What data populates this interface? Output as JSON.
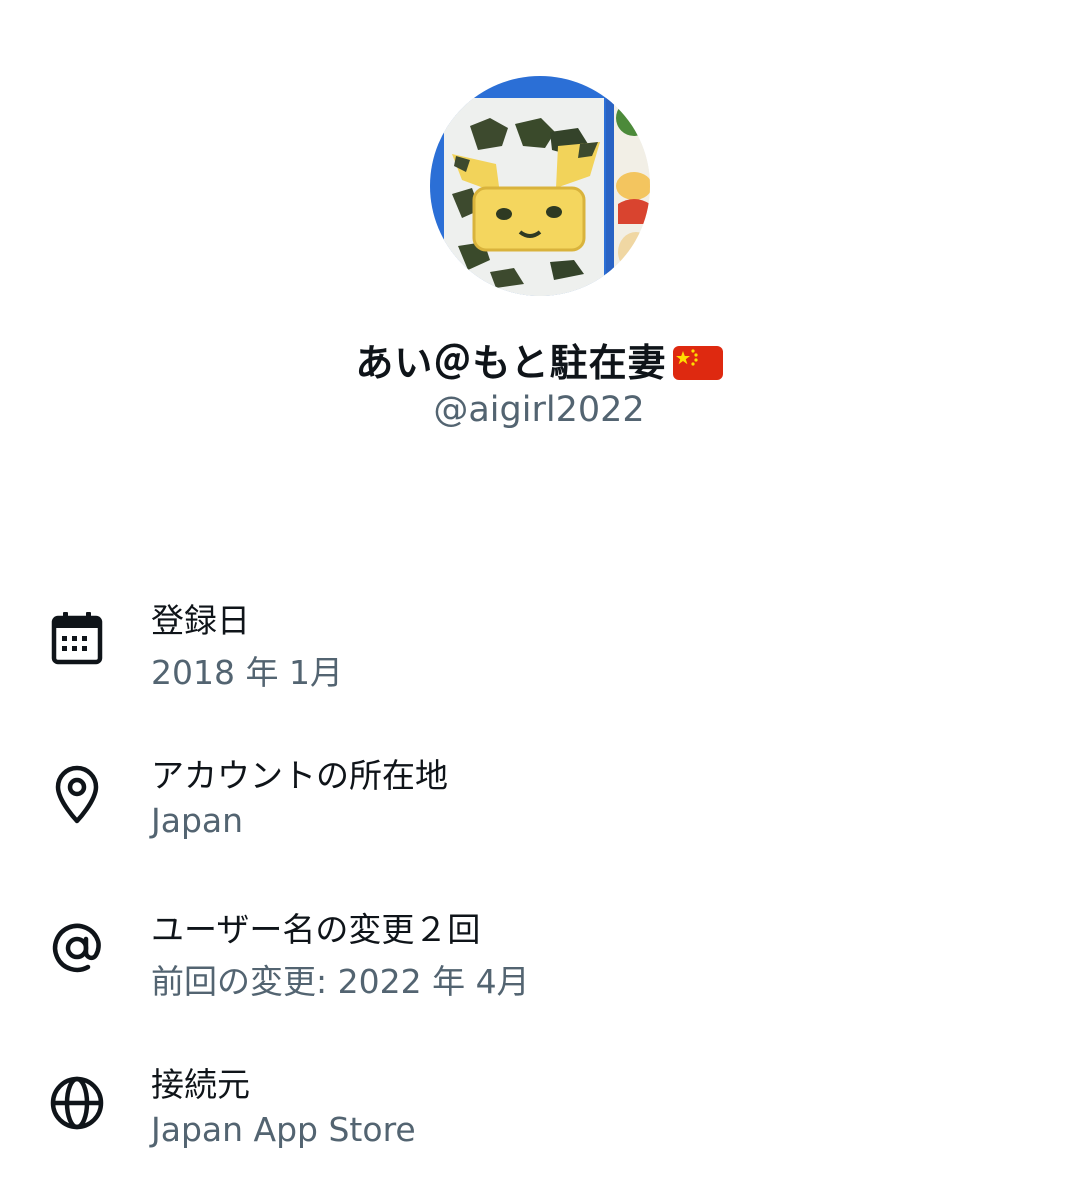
{
  "profile": {
    "display_name": "あい＠もと駐在妻",
    "handle": "@aigirl2022"
  },
  "icons": {
    "flag": "flag-china-icon"
  },
  "about": {
    "rows": [
      {
        "icon": "calendar-icon",
        "label": "登録日",
        "value": "2018 年 1月"
      },
      {
        "icon": "location-pin-icon",
        "label": "アカウントの所在地",
        "value": "Japan"
      },
      {
        "icon": "at-sign-icon",
        "label": "ユーザー名の変更２回",
        "value": "前回の変更: 2022 年 4月"
      },
      {
        "icon": "globe-icon",
        "label": "接続元",
        "value": "Japan App Store"
      }
    ]
  },
  "colors": {
    "primary_text": "#0f1419",
    "secondary_text": "#536471",
    "background": "#ffffff"
  }
}
